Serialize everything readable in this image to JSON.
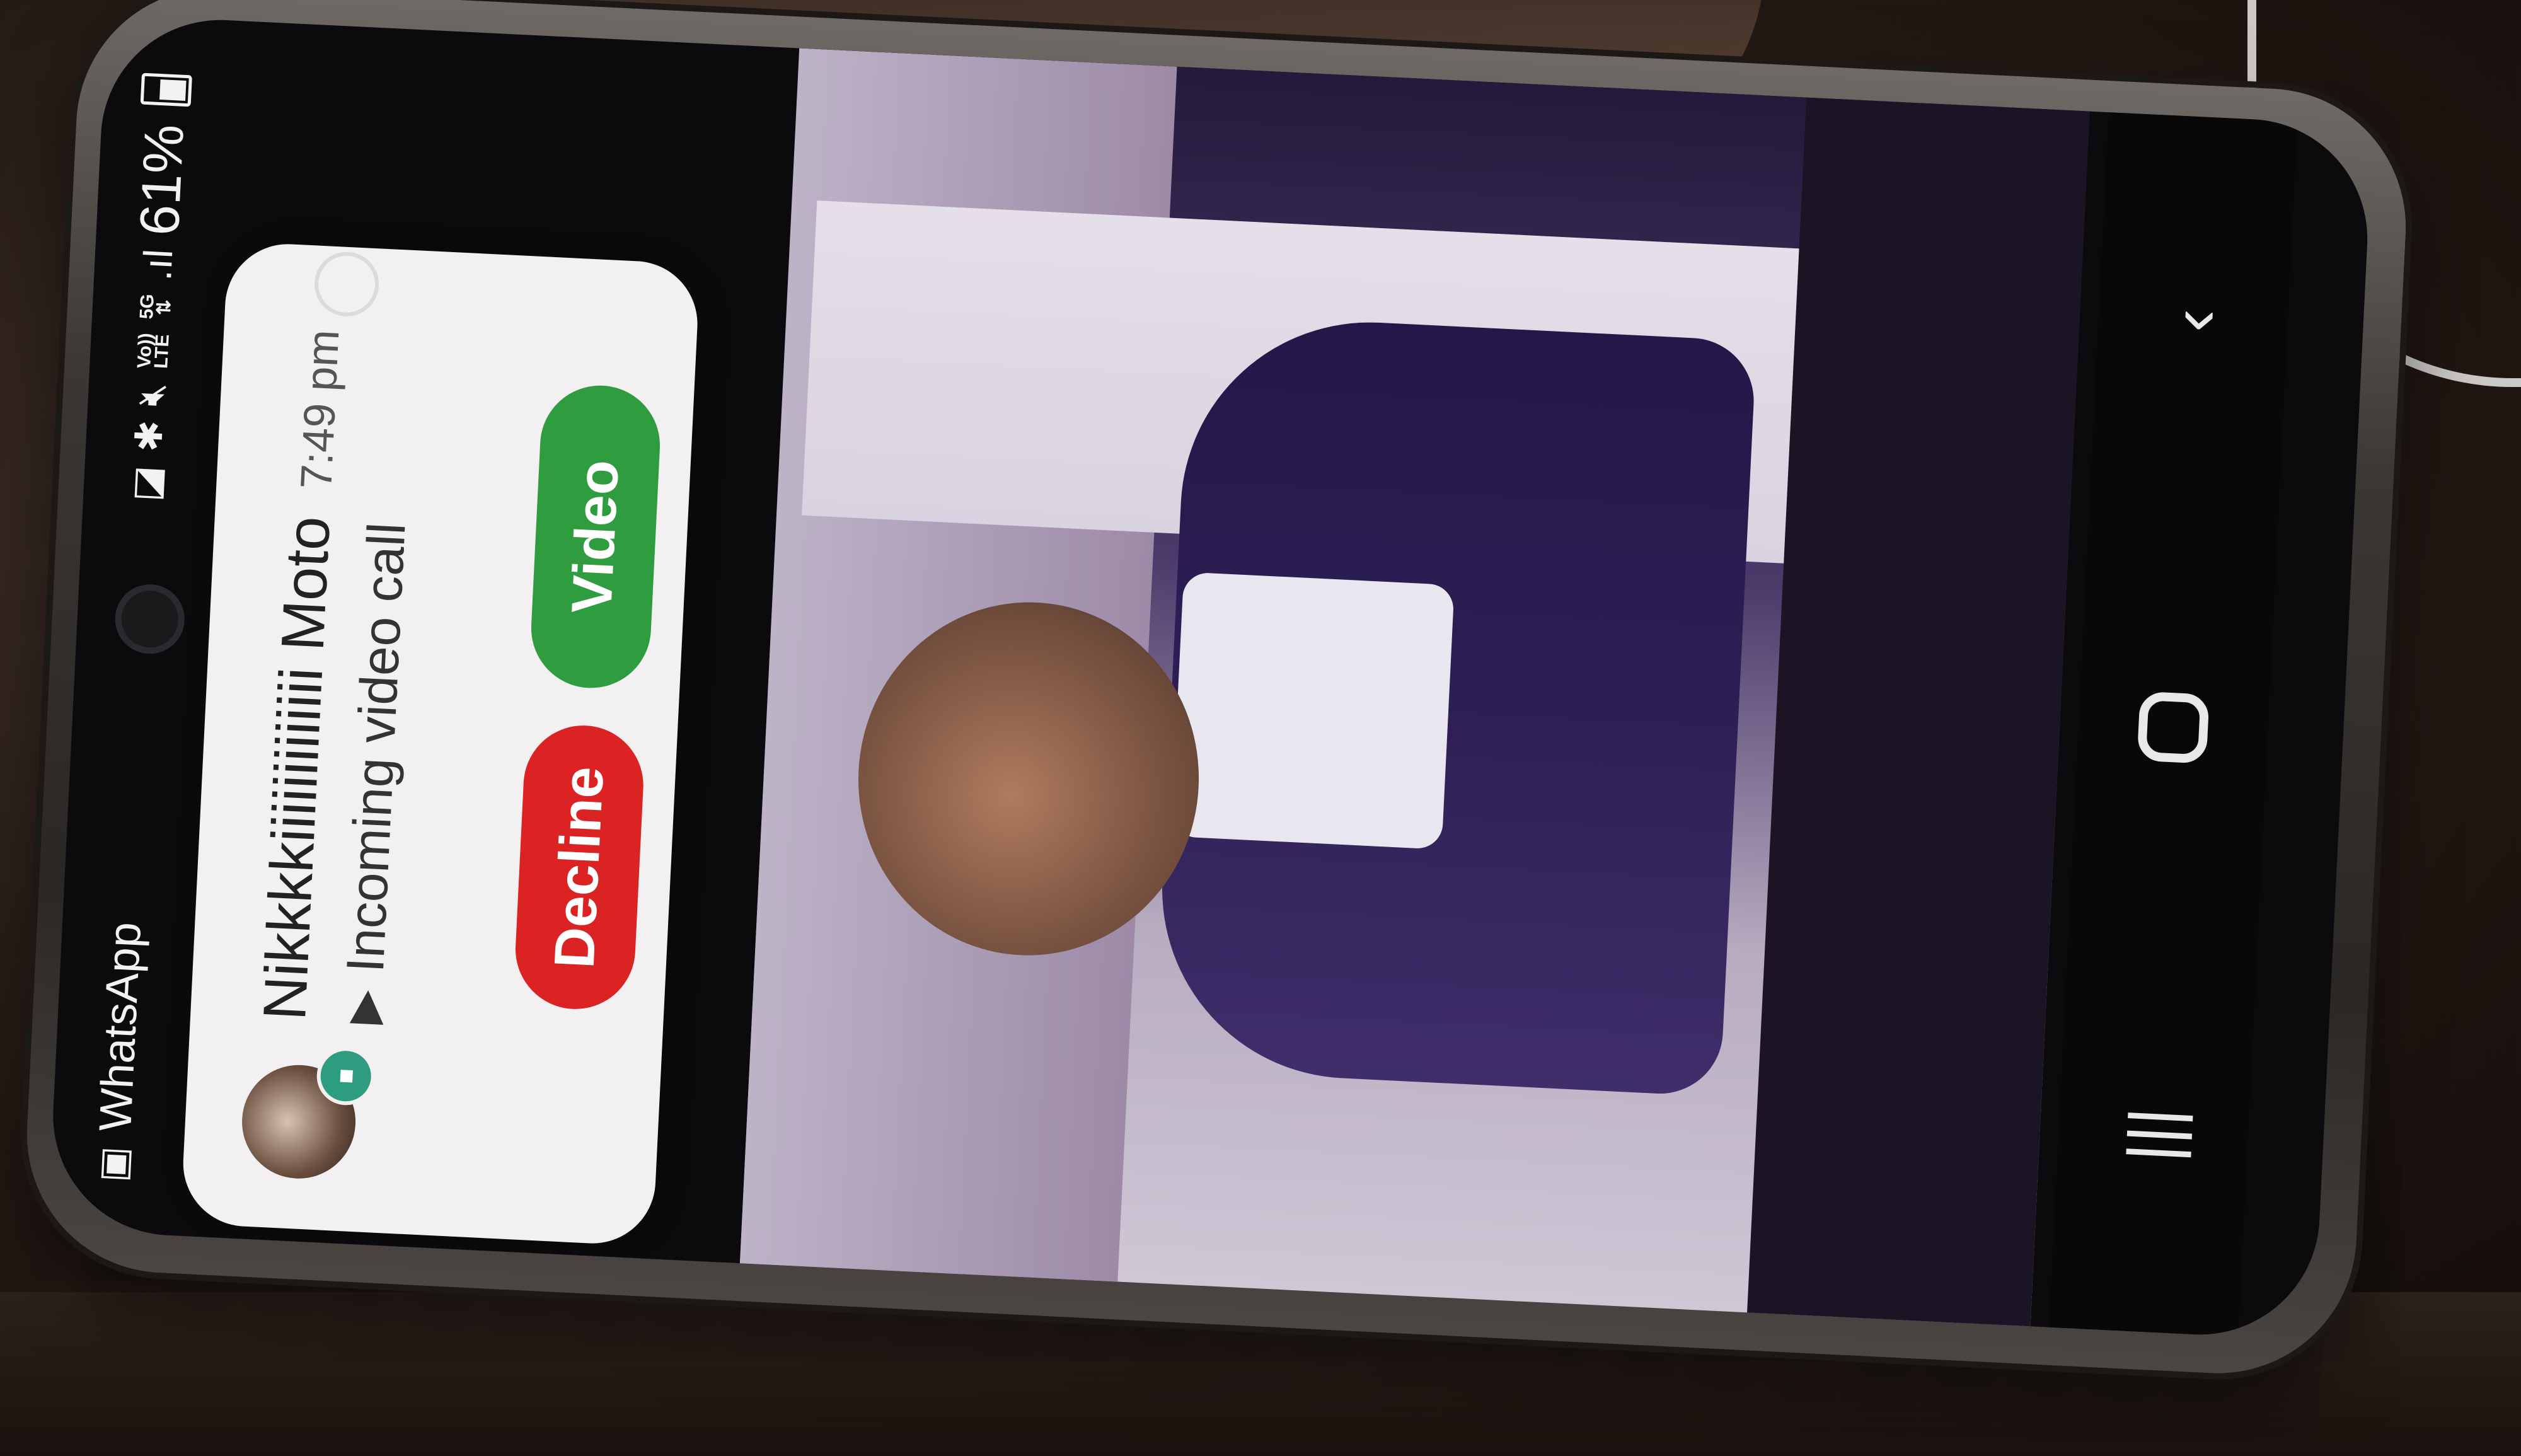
{
  "status_bar": {
    "app_name": "WhatsApp",
    "network_top": "Vo))",
    "network_bottom": "LTE",
    "net_5g": "5G",
    "net_lte_arrows": "⇅",
    "signal": ".ıl",
    "battery": "61%"
  },
  "notification": {
    "caller_name": "Nikkkkiiiiiiiiiiiii Moto",
    "time": "7:49 pm",
    "subtitle": "Incoming video call",
    "decline_label": "Decline",
    "accept_label": "Video",
    "accent_decline": "#dc2323",
    "accent_accept": "#2f9c3f"
  },
  "icons": {
    "app": "whatsapp-icon",
    "nfc": "nfc-icon",
    "bluetooth": "bluetooth-icon",
    "mute": "mute-icon",
    "video": "videocam-icon",
    "recent": "recents-icon",
    "home": "home-icon",
    "back": "back-icon"
  }
}
